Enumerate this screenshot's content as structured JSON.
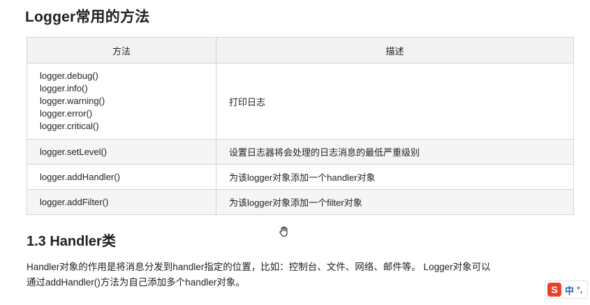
{
  "page": {
    "title": "Logger常用的方法"
  },
  "table": {
    "headers": {
      "method": "方法",
      "description": "描述"
    },
    "rows": [
      {
        "methods": [
          "logger.debug()",
          "logger.info()",
          "logger.warning()",
          "logger.error()",
          "logger.critical()"
        ],
        "description": "打印日志"
      },
      {
        "methods": [
          "logger.setLevel()"
        ],
        "description": "设置日志器将会处理的日志消息的最低严重级别"
      },
      {
        "methods": [
          "logger.addHandler()"
        ],
        "description": "为该logger对象添加一个handler对象"
      },
      {
        "methods": [
          "logger.addFilter()"
        ],
        "description": "为该logger对象添加一个filter对象"
      }
    ]
  },
  "section": {
    "title": "1.3 Handler类",
    "paragraph_line1": "Handler对象的作用是将消息分发到handler指定的位置，比如：控制台、文件、网络、邮件等。 Logger对象可以",
    "paragraph_line2": "通过addHandler()方法为自己添加多个handler对象。"
  },
  "ime": {
    "logo": "S",
    "mode": "中",
    "punct": "°,"
  },
  "icons": {
    "cursor": "hand-cursor-icon",
    "ime_logo": "sogou-logo-icon"
  }
}
